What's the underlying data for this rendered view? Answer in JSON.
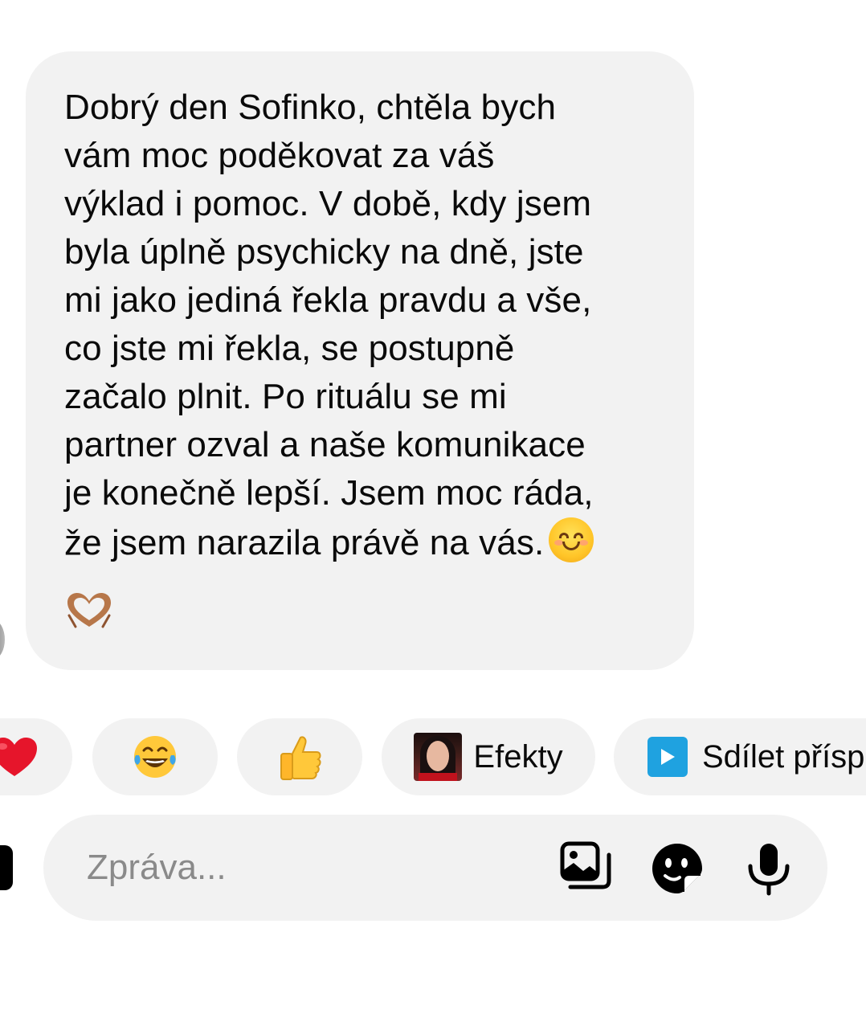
{
  "message": {
    "text": "Dobrý den Sofinko, chtěla bych\nvám moc poděkovat za váš\nvýklad i pomoc. V době, kdy jsem\nbyla úplně psychicky na dně, jste\nmi jako jediná řekla pravdu a vše,\nco jste mi řekla, se postupně\nzačalo plnit. Po rituálu se mi\npartner ozval a naše komunikace\nje konečně lepší. Jsem moc ráda,\nže jsem narazila právě na vás.",
    "emoji_1": "smiling-face-icon",
    "emoji_2": "heart-hands-icon"
  },
  "quick_replies": [
    {
      "icon": "red-heart-icon"
    },
    {
      "icon": "tears-of-joy-icon"
    },
    {
      "icon": "thumbs-up-icon"
    },
    {
      "icon": "effect-thumbnail",
      "label": "Efekty"
    },
    {
      "icon": "share-post-icon",
      "label": "Sdílet přísp"
    }
  ],
  "composer": {
    "placeholder": "Zpráva...",
    "icons": [
      "gallery-icon",
      "sticker-icon",
      "microphone-icon"
    ]
  },
  "colors": {
    "background": "#ffffff",
    "bubble": "#f2f2f2",
    "text": "#0a0a0a",
    "placeholder": "#8a8a8a",
    "share_accent": "#1fa2e0"
  }
}
